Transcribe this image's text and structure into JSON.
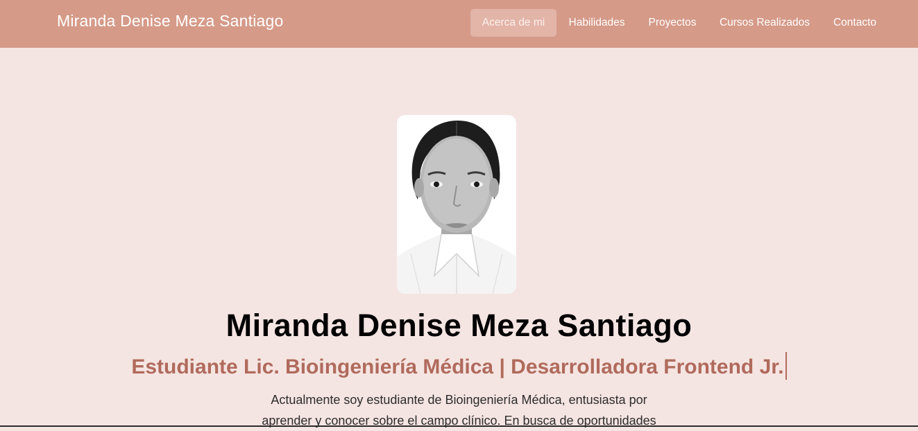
{
  "navbar": {
    "brand": "Miranda Denise Meza Santiago",
    "items": [
      {
        "label": "Acerca de mi",
        "active": true
      },
      {
        "label": "Habilidades",
        "active": false
      },
      {
        "label": "Proyectos",
        "active": false
      },
      {
        "label": "Cursos Realizados",
        "active": false
      },
      {
        "label": "Contacto",
        "active": false
      }
    ]
  },
  "hero": {
    "name": "Miranda Denise Meza Santiago",
    "role": "Estudiante Lic. Bioingeniería Médica | Desarrolladora Frontend Jr.",
    "description_lines": [
      "Actualmente soy estudiante de Bioingeniería Médica, entusiasta por",
      "aprender y conocer sobre el campo clínico. En busca de oportunidades"
    ]
  },
  "colors": {
    "navbar_bg": "#d69a88",
    "page_bg": "#f5e5e2",
    "accent": "#b06a5c",
    "active_nav_bg": "#e3b4a8"
  }
}
